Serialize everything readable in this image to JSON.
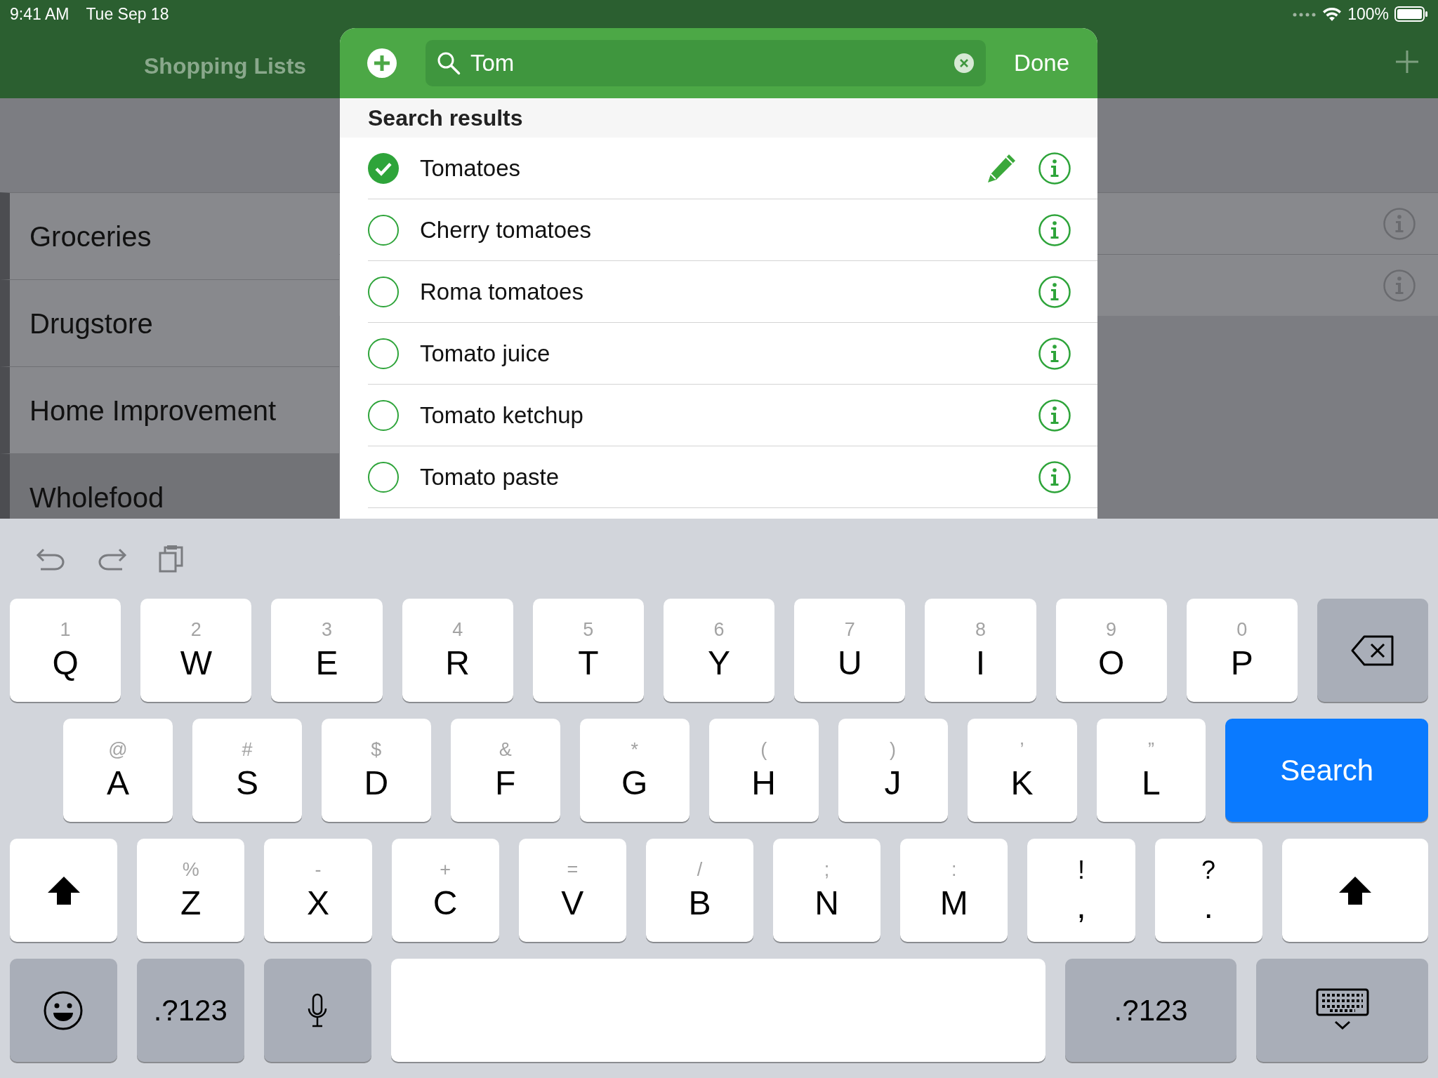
{
  "status_bar": {
    "time": "9:41 AM",
    "date": "Tue Sep 18",
    "battery": "100%"
  },
  "nav_bar": {
    "title": "Shopping Lists"
  },
  "lists": [
    {
      "name": "Groceries",
      "selected": false
    },
    {
      "name": "Drugstore",
      "selected": false
    },
    {
      "name": "Home Improvement",
      "selected": false
    },
    {
      "name": "Wholefood",
      "selected": true
    }
  ],
  "search": {
    "value": "Tom",
    "done": "Done"
  },
  "results": {
    "header": "Search results",
    "items": [
      {
        "name": "Tomatoes",
        "checked": true,
        "editable": true
      },
      {
        "name": "Cherry tomatoes",
        "checked": false,
        "editable": false
      },
      {
        "name": "Roma tomatoes",
        "checked": false,
        "editable": false
      },
      {
        "name": "Tomato juice",
        "checked": false,
        "editable": false
      },
      {
        "name": "Tomato ketchup",
        "checked": false,
        "editable": false
      },
      {
        "name": "Tomato paste",
        "checked": false,
        "editable": false
      }
    ]
  },
  "keyboard": {
    "rows": [
      [
        {
          "kind": "letter",
          "label": "Q",
          "hint": "1"
        },
        {
          "kind": "letter",
          "label": "W",
          "hint": "2"
        },
        {
          "kind": "letter",
          "label": "E",
          "hint": "3"
        },
        {
          "kind": "letter",
          "label": "R",
          "hint": "4"
        },
        {
          "kind": "letter",
          "label": "T",
          "hint": "5"
        },
        {
          "kind": "letter",
          "label": "Y",
          "hint": "6"
        },
        {
          "kind": "letter",
          "label": "U",
          "hint": "7"
        },
        {
          "kind": "letter",
          "label": "I",
          "hint": "8"
        },
        {
          "kind": "letter",
          "label": "O",
          "hint": "9"
        },
        {
          "kind": "letter",
          "label": "P",
          "hint": "0"
        },
        {
          "kind": "backspace"
        }
      ],
      [
        {
          "kind": "letter",
          "label": "A",
          "hint": "@"
        },
        {
          "kind": "letter",
          "label": "S",
          "hint": "#"
        },
        {
          "kind": "letter",
          "label": "D",
          "hint": "$"
        },
        {
          "kind": "letter",
          "label": "F",
          "hint": "&"
        },
        {
          "kind": "letter",
          "label": "G",
          "hint": "*"
        },
        {
          "kind": "letter",
          "label": "H",
          "hint": "("
        },
        {
          "kind": "letter",
          "label": "J",
          "hint": ")"
        },
        {
          "kind": "letter",
          "label": "K",
          "hint": "’"
        },
        {
          "kind": "letter",
          "label": "L",
          "hint": "”"
        },
        {
          "kind": "search",
          "label": "Search"
        }
      ],
      [
        {
          "kind": "shift"
        },
        {
          "kind": "letter",
          "label": "Z",
          "hint": "%"
        },
        {
          "kind": "letter",
          "label": "X",
          "hint": "-"
        },
        {
          "kind": "letter",
          "label": "C",
          "hint": "+"
        },
        {
          "kind": "letter",
          "label": "V",
          "hint": "="
        },
        {
          "kind": "letter",
          "label": "B",
          "hint": "/"
        },
        {
          "kind": "letter",
          "label": "N",
          "hint": ";"
        },
        {
          "kind": "letter",
          "label": "M",
          "hint": ":"
        },
        {
          "kind": "punct",
          "label": ",",
          "hint": "!"
        },
        {
          "kind": "punct",
          "label": ".",
          "hint": "?"
        },
        {
          "kind": "shift"
        }
      ],
      [
        {
          "kind": "emoji"
        },
        {
          "kind": "numbers",
          "label": ".?123"
        },
        {
          "kind": "mic"
        },
        {
          "kind": "space"
        },
        {
          "kind": "numbers",
          "label": ".?123"
        },
        {
          "kind": "hide"
        }
      ]
    ]
  }
}
